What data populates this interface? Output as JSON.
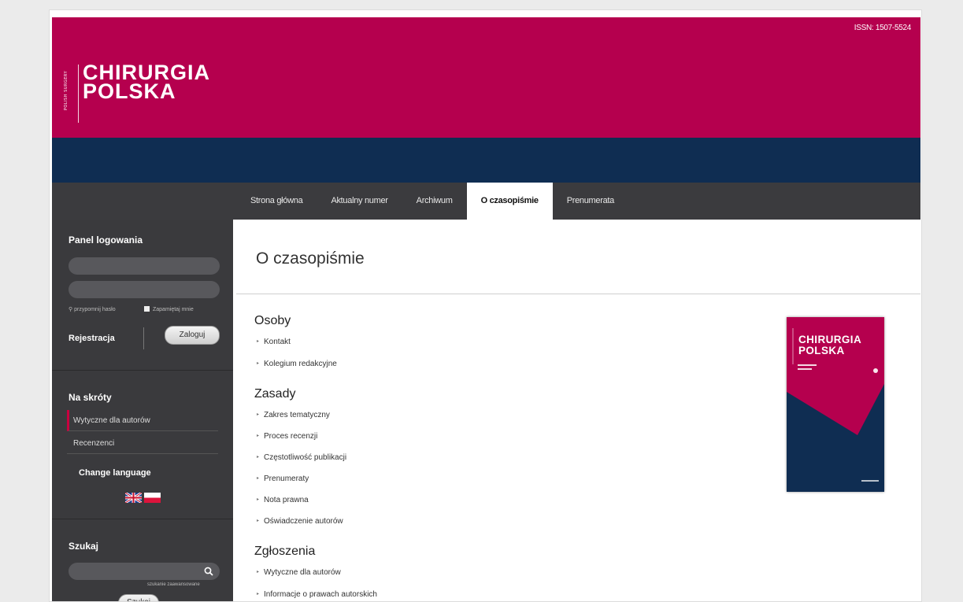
{
  "header": {
    "issn": "ISSN: 1507-5524",
    "logo_line1": "CHIRURGIA",
    "logo_line2": "POLSKA",
    "logo_side": "POLISH SURGERY",
    "brand_color": "#b5004e",
    "band_color": "#0f2d52"
  },
  "nav": {
    "items": [
      {
        "label": "Strona główna"
      },
      {
        "label": "Aktualny numer"
      },
      {
        "label": "Archiwum"
      },
      {
        "label": "O czasopiśmie",
        "active": true
      },
      {
        "label": "Prenumerata"
      }
    ]
  },
  "sidebar": {
    "login": {
      "title": "Panel logowania",
      "forgot_password": "przypomnij hasło",
      "remember_me": "Zapamiętaj mnie",
      "register": "Rejestracja",
      "login_button": "Zaloguj"
    },
    "shortcuts": {
      "title": "Na skróty",
      "items": [
        {
          "label": "Wytyczne dla autorów",
          "active": true
        },
        {
          "label": "Recenzenci"
        }
      ]
    },
    "language": {
      "title": "Change language",
      "flags": [
        "en",
        "pl"
      ]
    },
    "search": {
      "title": "Szukaj",
      "advanced": "szukanie zaawansowane",
      "button": "Szukaj",
      "icon": "search-icon"
    }
  },
  "main": {
    "title": "O czasopiśmie",
    "sections": [
      {
        "heading": "Osoby",
        "links": [
          "Kontakt",
          "Kolegium redakcyjne"
        ]
      },
      {
        "heading": "Zasady",
        "links": [
          "Zakres tematyczny",
          "Proces recenzji",
          "Częstotliwość publikacji",
          "Prenumeraty",
          "Nota prawna",
          "Oświadczenie autorów"
        ]
      },
      {
        "heading": "Zgłoszenia",
        "links": [
          "Wytyczne dla autorów",
          "Informacje o prawach autorskich"
        ]
      }
    ],
    "cover": {
      "title_line1": "CHIRURGIA",
      "title_line2": "POLSKA"
    }
  }
}
